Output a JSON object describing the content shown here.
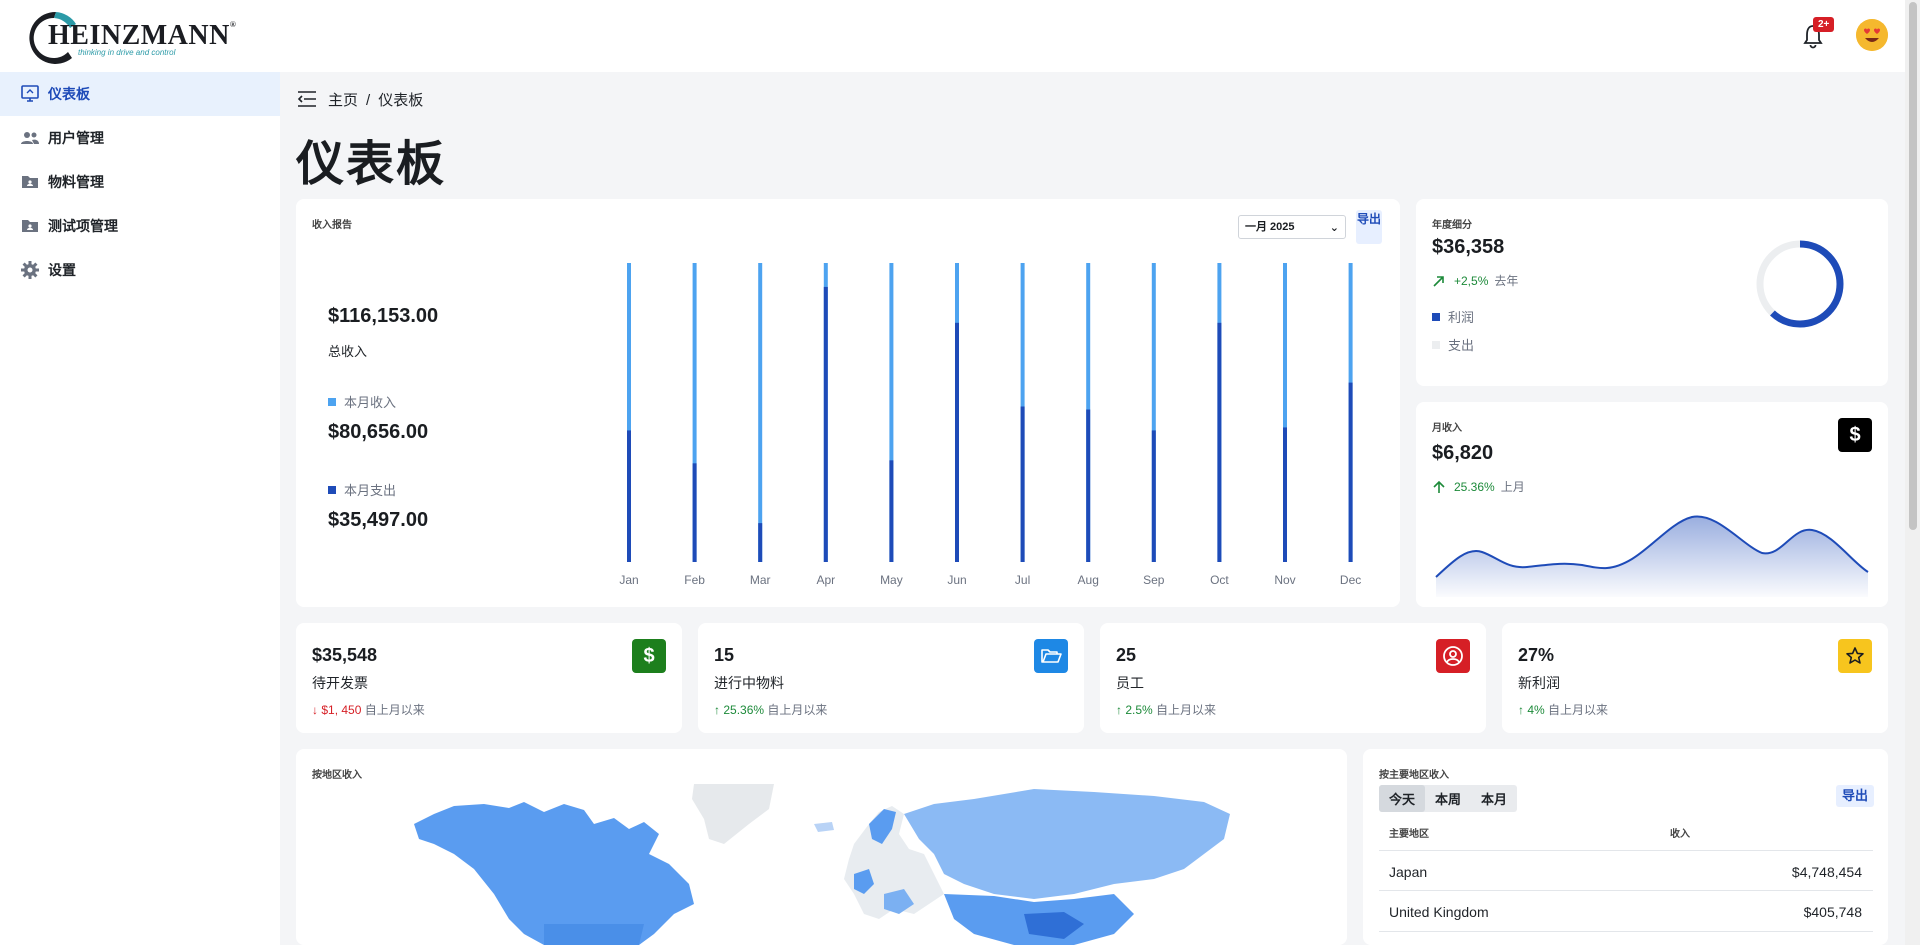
{
  "header": {
    "logo_text": "HEINZMANN",
    "logo_tagline": "thinking in drive and control",
    "notification_badge": "2+"
  },
  "sidebar": {
    "items": [
      {
        "label": "仪表板",
        "icon": "dashboard-icon"
      },
      {
        "label": "用户管理",
        "icon": "users-icon"
      },
      {
        "label": "物料管理",
        "icon": "folder-icon"
      },
      {
        "label": "测试项管理",
        "icon": "folder-icon"
      },
      {
        "label": "设置",
        "icon": "gear-icon"
      }
    ]
  },
  "breadcrumb": {
    "home": "主页",
    "separator": "/",
    "current": "仪表板"
  },
  "page_title": "仪表板",
  "revenue_report": {
    "label": "收入报告",
    "total": "$116,153.00",
    "total_label": "总收入",
    "income_label": "本月收入",
    "income_value": "$80,656.00",
    "expense_label": "本月支出",
    "expense_value": "$35,497.00",
    "month_select": "一月 2025",
    "export_label": "导出",
    "colors": {
      "income": "#4da3f0",
      "expense": "#1e4bb8"
    }
  },
  "chart_data": {
    "type": "bar",
    "categories": [
      "Jan",
      "Feb",
      "Mar",
      "Apr",
      "May",
      "Jun",
      "Jul",
      "Aug",
      "Sep",
      "Oct",
      "Nov",
      "Dec"
    ],
    "series": [
      {
        "name": "本月收入",
        "values": [
          1.0,
          1.0,
          1.0,
          1.0,
          1.0,
          1.0,
          1.0,
          1.0,
          1.0,
          1.0,
          1.0,
          1.0
        ]
      },
      {
        "name": "本月支出",
        "values": [
          0.44,
          0.33,
          0.13,
          0.92,
          0.34,
          0.8,
          0.52,
          0.51,
          0.44,
          0.8,
          0.45,
          0.6
        ]
      }
    ]
  },
  "annual": {
    "label": "年度细分",
    "value": "$36,358",
    "trend": "+2,5%",
    "trend_suffix": "去年",
    "legend_profit": "利润",
    "legend_expense": "支出",
    "profit_fraction": 0.62
  },
  "monthly": {
    "label": "月收入",
    "value": "$6,820",
    "trend": "25.36%",
    "trend_suffix": "上月"
  },
  "stats": [
    {
      "value": "$35,548",
      "label": "待开发票",
      "trend": "$1, 450",
      "dir": "down",
      "suffix": "自上月以来",
      "icon": "dollar-icon",
      "color": "#1d7f1d"
    },
    {
      "value": "15",
      "label": "进行中物料",
      "trend": "25.36%",
      "dir": "up",
      "suffix": "自上月以来",
      "icon": "folder-open-icon",
      "color": "#1e88e5"
    },
    {
      "value": "25",
      "label": "员工",
      "trend": "2.5%",
      "dir": "up",
      "suffix": "自上月以来",
      "icon": "user-circle-icon",
      "color": "#d61f26"
    },
    {
      "value": "27%",
      "label": "新利润",
      "trend": "4%",
      "dir": "up",
      "suffix": "自上月以来",
      "icon": "star-icon",
      "color": "#f7c51e"
    }
  ],
  "map": {
    "label": "按地区收入"
  },
  "regions": {
    "label": "按主要地区收入",
    "tabs": [
      "今天",
      "本周",
      "本月"
    ],
    "export_label": "导出",
    "col_region": "主要地区",
    "col_revenue": "收入",
    "rows": [
      {
        "region": "Japan",
        "revenue": "$4,748,454"
      },
      {
        "region": "United Kingdom",
        "revenue": "$405,748"
      }
    ]
  }
}
